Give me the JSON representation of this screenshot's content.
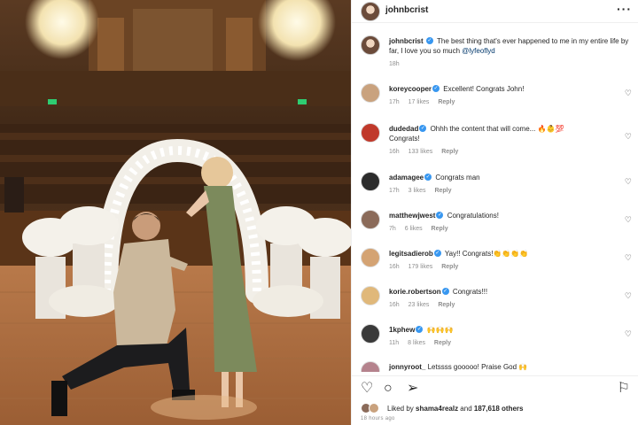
{
  "post": {
    "username": "johnbcrist",
    "more_icon": "more-horizontal-icon",
    "caption": {
      "username": "johnbcrist",
      "text": "The best thing that's ever happened to me in my entire life by far, I love you so much",
      "mention": "@lyfeoflyd",
      "time": "18h"
    }
  },
  "comments": [
    {
      "username": "koreycooper",
      "text": "Excellent! Congrats John!",
      "time": "17h",
      "likes": "17 likes",
      "reply": "Reply",
      "avatar_color": "#c9a27e"
    },
    {
      "username": "dudedad",
      "text": "Ohhh the content that will come... 🔥👶💯",
      "text2": "Congrats!",
      "time": "16h",
      "likes": "133 likes",
      "reply": "Reply",
      "avatar_color": "#c0392b"
    },
    {
      "username": "adamagee",
      "text": "Congrats man",
      "time": "17h",
      "likes": "3 likes",
      "reply": "Reply",
      "avatar_color": "#2c2c2c"
    },
    {
      "username": "matthewjwest",
      "text": "Congratulations!",
      "time": "7h",
      "likes": "6 likes",
      "reply": "Reply",
      "avatar_color": "#8b6b5a"
    },
    {
      "username": "legitsadierob",
      "text": "Yay!! Congrats!👏👏👏👏",
      "time": "16h",
      "likes": "179 likes",
      "reply": "Reply",
      "avatar_color": "#d4a373"
    },
    {
      "username": "korie.robertson",
      "text": "Congrats!!!",
      "time": "16h",
      "likes": "23 likes",
      "reply": "Reply",
      "avatar_color": "#e0b87a"
    },
    {
      "username": "1kphew",
      "text": "🙌🙌🙌",
      "time": "11h",
      "likes": "8 likes",
      "reply": "Reply",
      "avatar_color": "#3a3a3a"
    },
    {
      "username": "jonnyroot_",
      "text": "Letssss gooooo! Praise God 🙌",
      "time": "",
      "likes": "",
      "reply": "",
      "avatar_color": "#b5838d"
    }
  ],
  "actions": {
    "like_icon": "heart-icon",
    "comment_icon": "comment-icon",
    "share_icon": "share-icon",
    "save_icon": "bookmark-icon"
  },
  "likes": {
    "prefix": "Liked by",
    "user": "shama4realz",
    "and": "and",
    "others": "187,618 others"
  },
  "time_ago": "18 hours ago",
  "colors": {
    "verified": "#3897f0",
    "mention": "#00376b",
    "meta": "#8e8e8e"
  }
}
